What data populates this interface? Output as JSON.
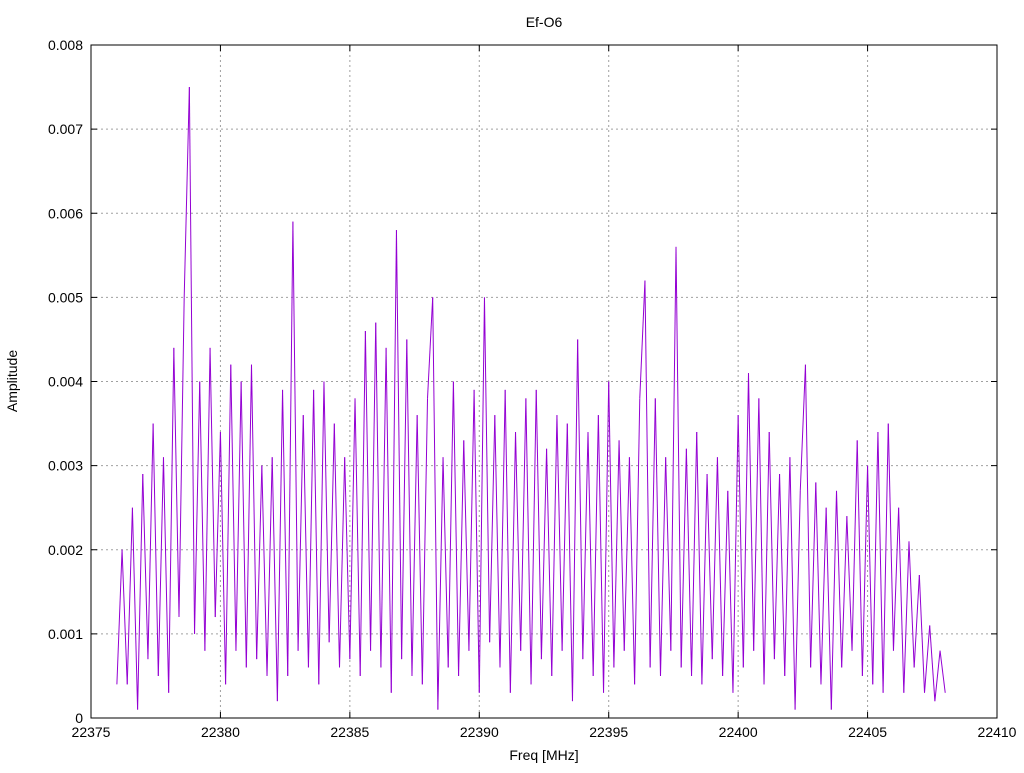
{
  "chart_data": {
    "type": "line",
    "title": "Ef-O6",
    "xlabel": "Freq [MHz]",
    "ylabel": "Amplitude",
    "xlim": [
      22375,
      22410
    ],
    "ylim": [
      0,
      0.008
    ],
    "grid": true,
    "legend": "none",
    "series_color": "#9400d3",
    "x_ticks": [
      "22375",
      "22380",
      "22385",
      "22390",
      "22395",
      "22400",
      "22405",
      "22410"
    ],
    "x_tick_values": [
      22375,
      22380,
      22385,
      22390,
      22395,
      22400,
      22405,
      22410
    ],
    "y_ticks": [
      "0",
      "0.001",
      "0.002",
      "0.003",
      "0.004",
      "0.005",
      "0.006",
      "0.007",
      "0.008"
    ],
    "y_tick_values": [
      0,
      0.001,
      0.002,
      0.003,
      0.004,
      0.005,
      0.006,
      0.007,
      0.008
    ],
    "x_start": 22376.0,
    "x_step": 0.2,
    "values": [
      0.0004,
      0.002,
      0.0004,
      0.0025,
      0.0001,
      0.0029,
      0.0007,
      0.0035,
      0.0005,
      0.0031,
      0.0003,
      0.0044,
      0.0012,
      0.005,
      0.0075,
      0.001,
      0.004,
      0.0008,
      0.0044,
      0.0012,
      0.0034,
      0.0004,
      0.0042,
      0.0008,
      0.004,
      0.0006,
      0.0042,
      0.0007,
      0.003,
      0.0005,
      0.0031,
      0.0002,
      0.0039,
      0.0005,
      0.0059,
      0.0008,
      0.0036,
      0.0006,
      0.0039,
      0.0004,
      0.004,
      0.0009,
      0.0035,
      0.0006,
      0.0031,
      0.0007,
      0.0038,
      0.0005,
      0.0046,
      0.0008,
      0.0047,
      0.0006,
      0.0044,
      0.0003,
      0.0058,
      0.0007,
      0.0045,
      0.0005,
      0.0036,
      0.0004,
      0.0038,
      0.005,
      0.0001,
      0.0031,
      0.0006,
      0.004,
      0.0005,
      0.0033,
      0.0008,
      0.0039,
      0.0003,
      0.005,
      0.0009,
      0.0036,
      0.0006,
      0.0039,
      0.0003,
      0.0034,
      0.0008,
      0.0038,
      0.0004,
      0.0039,
      0.0007,
      0.0032,
      0.0005,
      0.0036,
      0.0008,
      0.0035,
      0.0002,
      0.0045,
      0.0007,
      0.0034,
      0.0005,
      0.0036,
      0.0003,
      0.004,
      0.0006,
      0.0033,
      0.0008,
      0.0031,
      0.0004,
      0.0038,
      0.0052,
      0.0006,
      0.0038,
      0.0005,
      0.0031,
      0.0008,
      0.0056,
      0.0006,
      0.0032,
      0.0005,
      0.0034,
      0.0004,
      0.0029,
      0.0007,
      0.0031,
      0.0005,
      0.0027,
      0.0003,
      0.0036,
      0.0006,
      0.0041,
      0.0008,
      0.0038,
      0.0004,
      0.0034,
      0.0007,
      0.0029,
      0.0005,
      0.0031,
      0.0001,
      0.0027,
      0.0042,
      0.0006,
      0.0028,
      0.0004,
      0.0025,
      0.0001,
      0.0027,
      0.0006,
      0.0024,
      0.0008,
      0.0033,
      0.0005,
      0.003,
      0.0004,
      0.0034,
      0.0003,
      0.0035,
      0.0008,
      0.0025,
      0.0003,
      0.0021,
      0.0006,
      0.0017,
      0.0003,
      0.0011,
      0.0002,
      0.0008,
      0.0003
    ]
  }
}
